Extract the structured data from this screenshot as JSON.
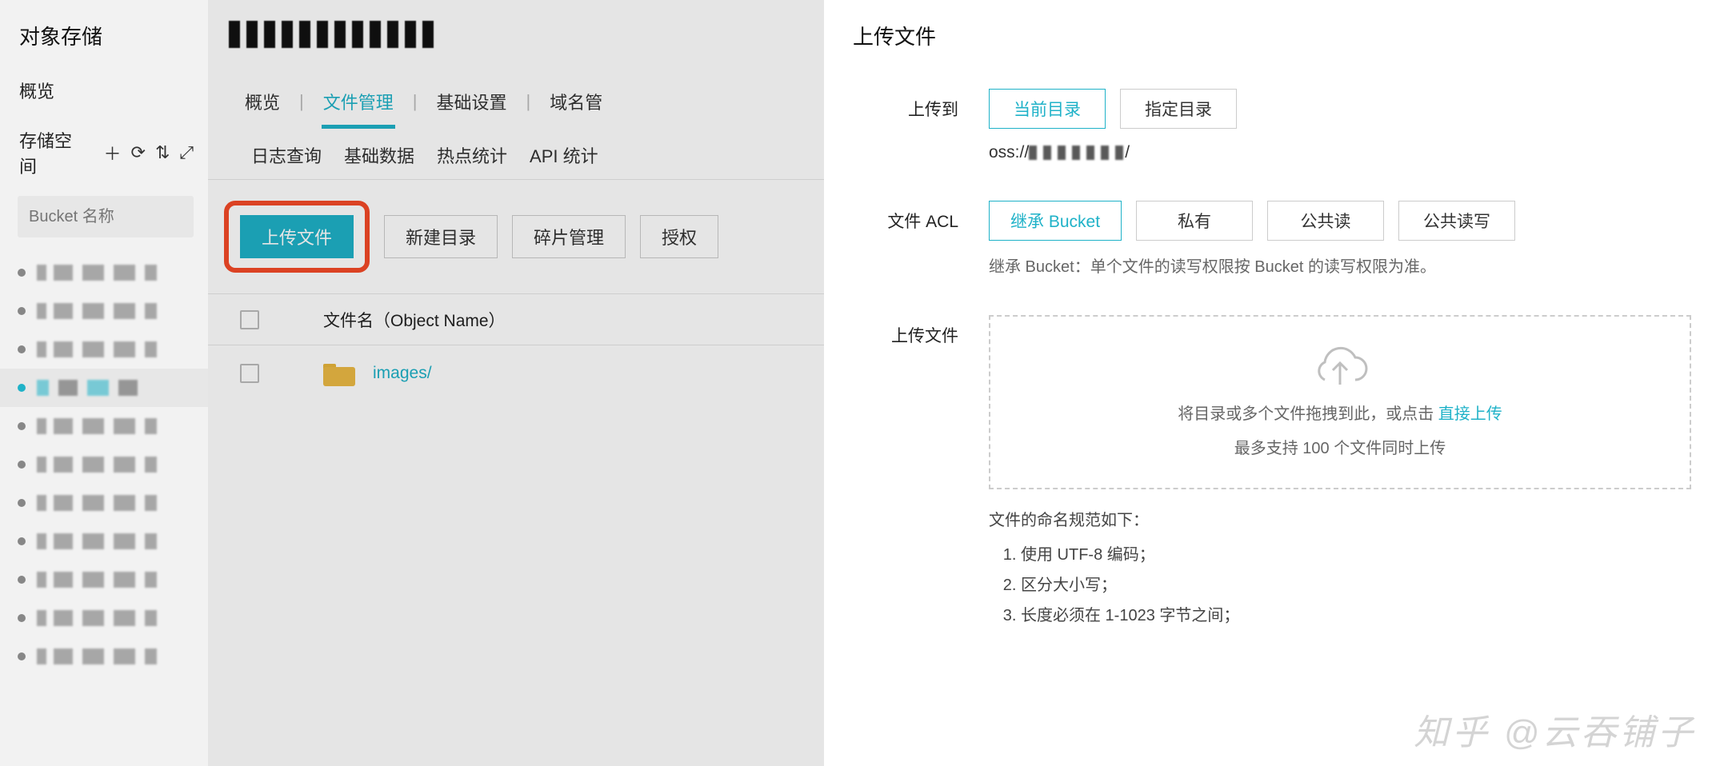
{
  "sidebar": {
    "service_title": "对象存储",
    "overview": "概览",
    "storage_label": "存储空间",
    "search_placeholder": "Bucket 名称",
    "icons": {
      "add": "＋",
      "refresh": "⟳",
      "sort": "⇅",
      "expand": "⤢"
    },
    "buckets": [
      {
        "active": false,
        "color": "grey"
      },
      {
        "active": false,
        "color": "grey"
      },
      {
        "active": false,
        "color": "grey"
      },
      {
        "active": true,
        "color": "blue"
      },
      {
        "active": false,
        "color": "grey"
      },
      {
        "active": false,
        "color": "grey"
      },
      {
        "active": false,
        "color": "grey"
      },
      {
        "active": false,
        "color": "grey"
      },
      {
        "active": false,
        "color": "grey"
      },
      {
        "active": false,
        "color": "grey"
      },
      {
        "active": false,
        "color": "grey"
      }
    ]
  },
  "main": {
    "tabs1": [
      {
        "label": "概览",
        "active": false
      },
      {
        "label": "文件管理",
        "active": true
      },
      {
        "label": "基础设置",
        "active": false
      },
      {
        "label": "域名管",
        "active": false
      }
    ],
    "tabs2": [
      {
        "label": "日志查询"
      },
      {
        "label": "基础数据"
      },
      {
        "label": "热点统计"
      },
      {
        "label": "API 统计"
      }
    ],
    "toolbar": {
      "upload": "上传文件",
      "mkdir": "新建目录",
      "fragments": "碎片管理",
      "authorize": "授权"
    },
    "table": {
      "header_name": "文件名（Object Name）",
      "rows": [
        {
          "type": "folder",
          "name": "images/"
        }
      ]
    }
  },
  "panel": {
    "title": "上传文件",
    "upload_to": {
      "label": "上传到",
      "options": [
        {
          "label": "当前目录",
          "active": true
        },
        {
          "label": "指定目录",
          "active": false
        }
      ],
      "path_prefix": "oss://",
      "path_suffix": "/"
    },
    "acl": {
      "label": "文件 ACL",
      "options": [
        {
          "label": "继承 Bucket",
          "active": true
        },
        {
          "label": "私有",
          "active": false
        },
        {
          "label": "公共读",
          "active": false
        },
        {
          "label": "公共读写",
          "active": false
        }
      ],
      "hint": "继承 Bucket：单个文件的读写权限按 Bucket 的读写权限为准。"
    },
    "upload_area": {
      "label": "上传文件",
      "line1a": "将目录或多个文件拖拽到此，或点击",
      "direct": "直接上传",
      "line2": "最多支持 100 个文件同时上传"
    },
    "rules": {
      "title": "文件的命名规范如下：",
      "items": [
        "使用 UTF-8 编码；",
        "区分大小写；",
        "长度必须在 1-1023 字节之间；"
      ]
    }
  },
  "watermark": "知乎 @云吞铺子"
}
